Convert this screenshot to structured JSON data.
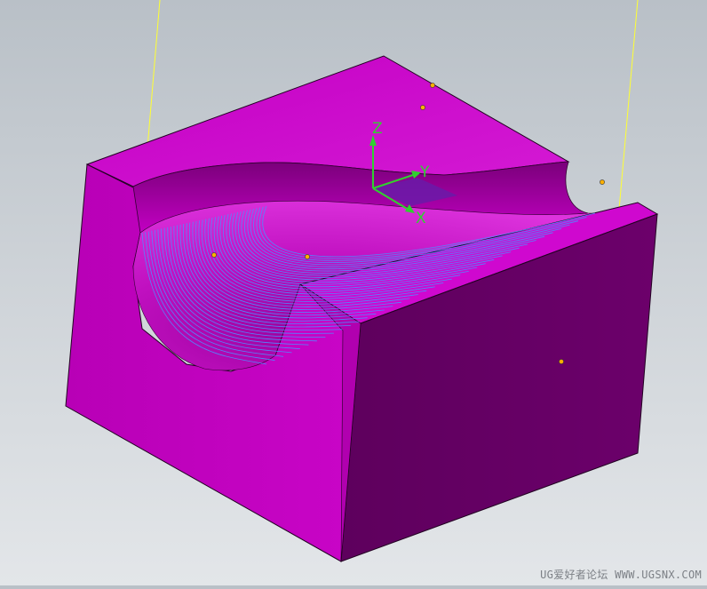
{
  "app": {
    "view": "3D model viewport",
    "background_top": "#b9c0c7",
    "background_bottom": "#e3e6e9"
  },
  "model": {
    "part_color": "#cc00cc",
    "dark_face_color": "#6a0068",
    "toolpath_color": "#4f8cff",
    "wire_color": "#ffff33"
  },
  "wcs": {
    "x_label": "X",
    "y_label": "Y",
    "z_label": "Z",
    "axis_color": "#2fd12f"
  },
  "watermark": {
    "text": "UG爱好者论坛 WWW.UGSNX.COM"
  }
}
